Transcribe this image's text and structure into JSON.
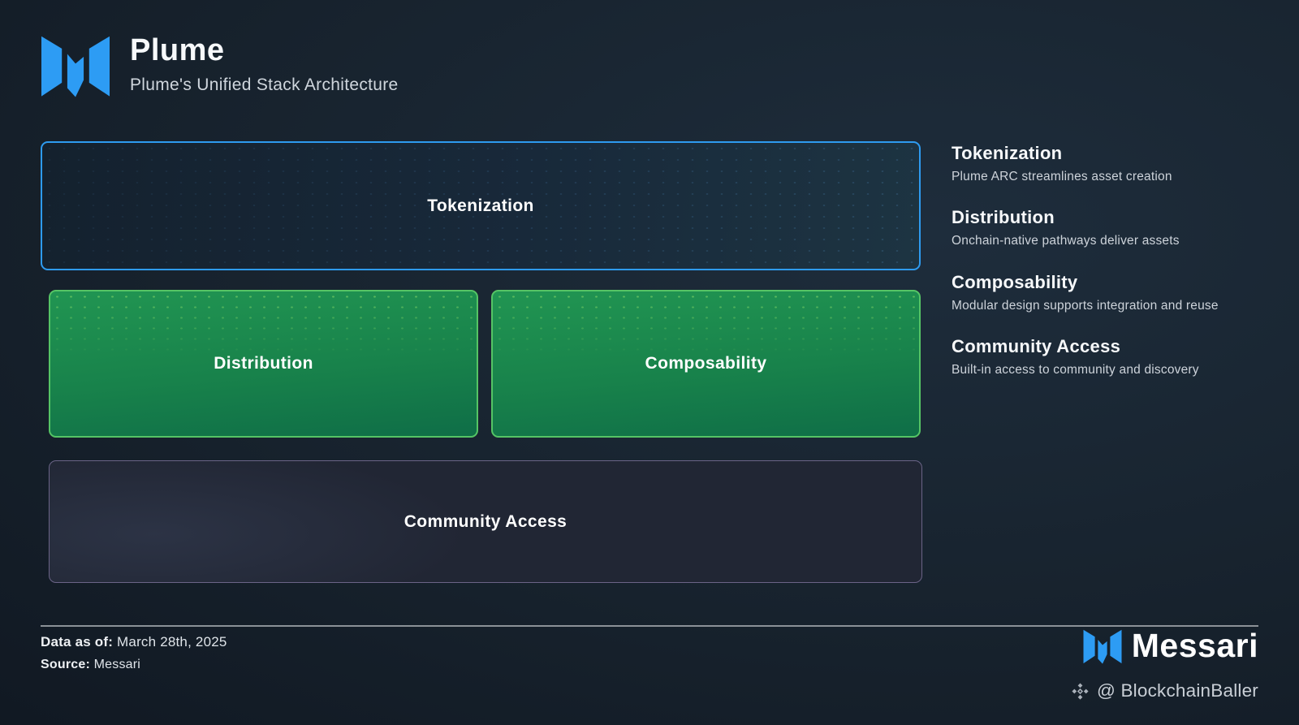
{
  "header": {
    "title": "Plume",
    "subtitle": "Plume's Unified Stack Architecture"
  },
  "stack": {
    "tokenization": "Tokenization",
    "distribution": "Distribution",
    "composability": "Composability",
    "community": "Community Access"
  },
  "descriptions": [
    {
      "title": "Tokenization",
      "text": "Plume ARC streamlines asset creation"
    },
    {
      "title": "Distribution",
      "text": "Onchain-native pathways deliver assets"
    },
    {
      "title": "Composability",
      "text": "Modular design supports integration and reuse"
    },
    {
      "title": "Community Access",
      "text": "Built-in access to community and discovery"
    }
  ],
  "footer": {
    "data_as_of_label": "Data as of:",
    "data_as_of_value": "March 28th, 2025",
    "source_label": "Source:",
    "source_value": "Messari",
    "brand_name": "Messari",
    "credit": "@ BlockchainBaller"
  },
  "icons": {
    "header_logo": "messari-m-logo",
    "footer_logo": "messari-m-logo",
    "credit_icon": "diamond-cluster-icon"
  },
  "colors": {
    "accent_blue": "#2D9CF4",
    "tokenization_border": "#2E9BF0",
    "green_border": "#55C465",
    "green_fill_top": "#219552",
    "green_fill_bottom": "#0F6E47",
    "community_border": "#6B6487",
    "background": "#141D27"
  }
}
